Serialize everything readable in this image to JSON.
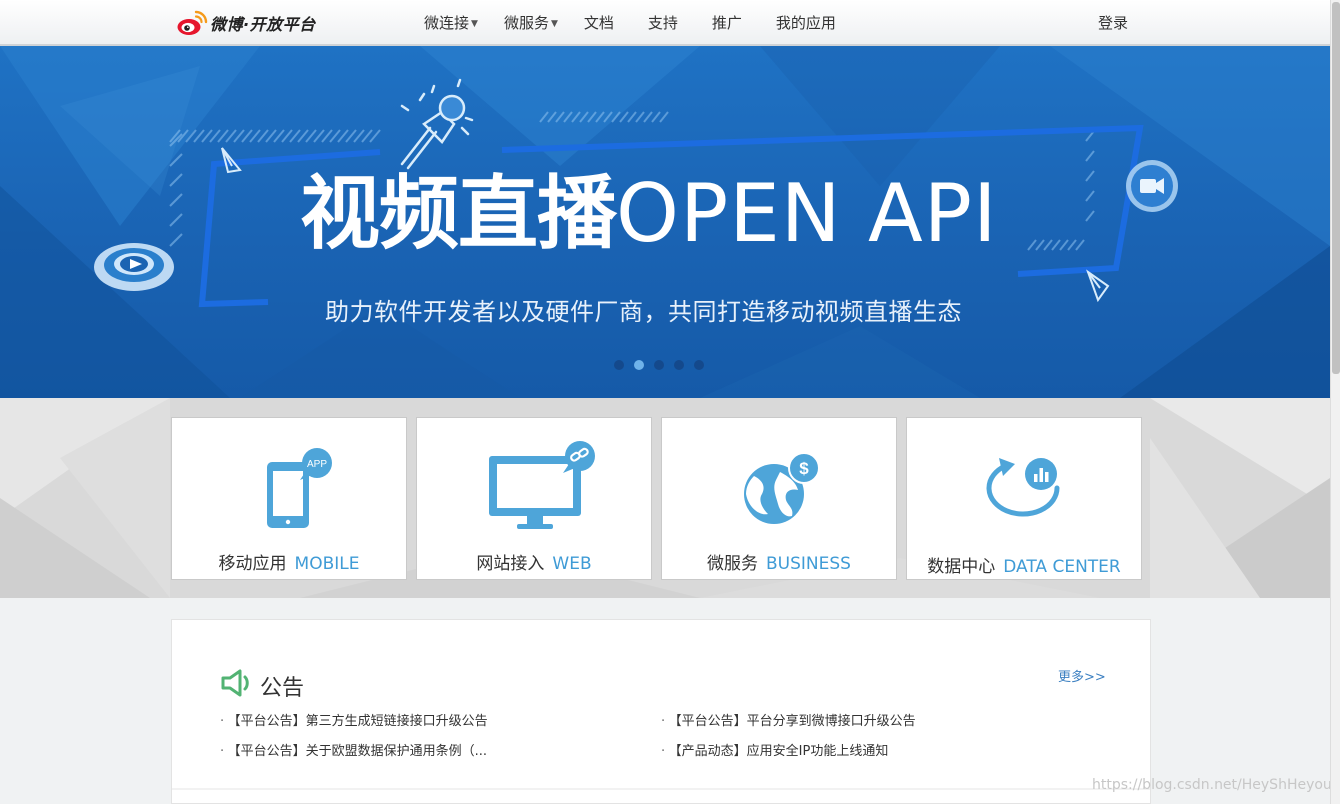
{
  "header": {
    "logo_text": "微博·开放平台",
    "nav": [
      {
        "label": "微连接",
        "caret": "▼"
      },
      {
        "label": "微服务",
        "caret": "▼"
      },
      {
        "label": "文档"
      },
      {
        "label": "支持"
      },
      {
        "label": "推广"
      },
      {
        "label": "我的应用"
      }
    ],
    "login_label": "登录"
  },
  "banner": {
    "title_cn": "视频直播",
    "title_en": "OPEN API",
    "subtitle": "助力软件开发者以及硬件厂商，共同打造移动视频直播生态",
    "slides": 5,
    "active_slide": 2
  },
  "categories": [
    {
      "label": "移动应用",
      "label_en": "MOBILE",
      "badge": "APP",
      "icon": "mobile-phone-icon"
    },
    {
      "label": "网站接入",
      "label_en": "WEB",
      "icon": "monitor-link-icon"
    },
    {
      "label": "微服务",
      "label_en": "BUSINESS",
      "badge": "$",
      "icon": "globe-dollar-icon"
    },
    {
      "label": "数据中心",
      "label_en": "DATA CENTER",
      "icon": "data-chart-icon"
    }
  ],
  "notice": {
    "title": "公告",
    "more": "更多>>",
    "bullet": "·",
    "items": [
      "【平台公告】第三方生成短链接接口升级公告",
      "【平台公告】平台分享到微博接口升级公告",
      "【平台公告】关于欧盟数据保护通用条例（...",
      "【产品动态】应用安全IP功能上线通知"
    ]
  },
  "watermark": "https://blog.csdn.net/HeyShHeyou",
  "colors": {
    "accent": "#3f9bd6",
    "banner_blue": "#1a63b3",
    "notice_green": "#52b373",
    "link_blue": "#3b7fc1"
  }
}
